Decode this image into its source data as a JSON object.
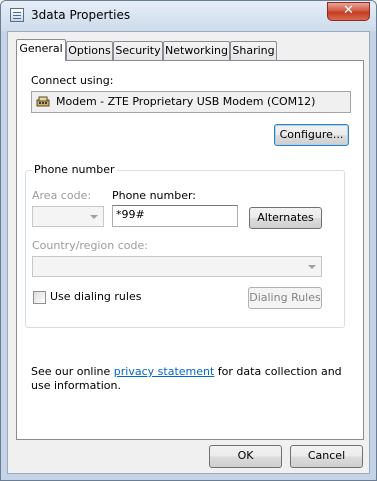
{
  "window": {
    "title": "3data Properties",
    "close_glyph": "✕"
  },
  "tabs": [
    {
      "label": "General",
      "active": true
    },
    {
      "label": "Options",
      "active": false
    },
    {
      "label": "Security",
      "active": false
    },
    {
      "label": "Networking",
      "active": false
    },
    {
      "label": "Sharing",
      "active": false
    }
  ],
  "general": {
    "connect_using_label": "Connect using:",
    "device_name": "Modem - ZTE Proprietary USB Modem (COM12)",
    "device_icon": "modem-icon",
    "configure_button": "Configure...",
    "phone_group_title": "Phone number",
    "area_code_label": "Area code:",
    "area_code_value": "",
    "phone_number_label": "Phone number:",
    "phone_number_value": "*99#",
    "alternates_button": "Alternates",
    "country_label": "Country/region code:",
    "country_value": "",
    "use_dialing_rules_label": "Use dialing rules",
    "use_dialing_rules_checked": false,
    "dialing_rules_button": "Dialing Rules",
    "privacy_prefix": "See our online ",
    "privacy_link": "privacy statement",
    "privacy_suffix": " for data collection and use information."
  },
  "footer": {
    "ok_button": "OK",
    "cancel_button": "Cancel"
  }
}
